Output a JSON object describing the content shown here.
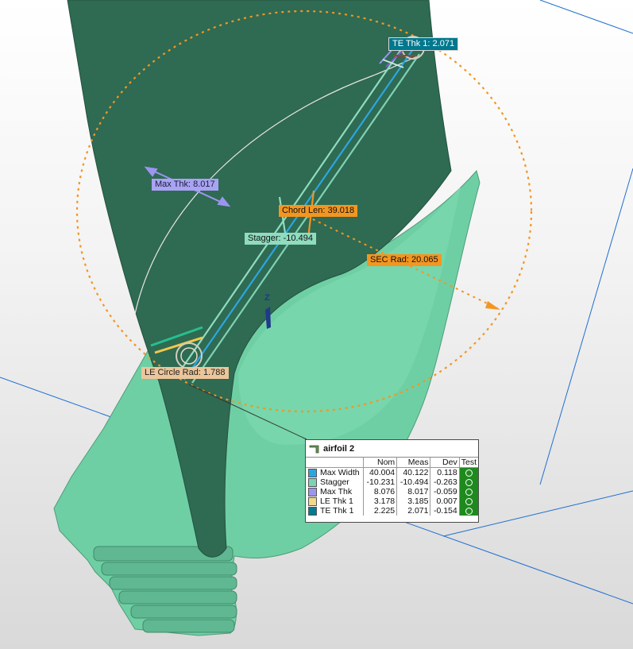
{
  "callouts": {
    "te_thk": "TE Thk 1: 2.071",
    "max_thk": "Max Thk: 8.017",
    "chord_len": "Chord Len: 39.018",
    "stagger": "Stagger: -10.494",
    "sec_rad": "SEC Rad: 20.065",
    "le_circle_rad": "LE Circle Rad: 1.788"
  },
  "axis_label": "Z",
  "panel": {
    "title": "airfoil 2",
    "headers": [
      "",
      "",
      "Nom",
      "Meas",
      "Dev",
      "Test"
    ],
    "rows": [
      {
        "color": "#2aa7e0",
        "name": "Max Width",
        "nom": "40.004",
        "meas": "40.122",
        "dev": "0.118"
      },
      {
        "color": "#7fd2b5",
        "name": "Stagger",
        "nom": "-10.231",
        "meas": "-10.494",
        "dev": "-0.263"
      },
      {
        "color": "#9b95f0",
        "name": "Max Thk",
        "nom": "8.076",
        "meas": "8.017",
        "dev": "-0.059"
      },
      {
        "color": "#f2d88a",
        "name": "LE Thk 1",
        "nom": "3.178",
        "meas": "3.185",
        "dev": "0.007"
      },
      {
        "color": "#007b8f",
        "name": "TE Thk 1",
        "nom": "2.225",
        "meas": "2.071",
        "dev": "-0.154"
      }
    ]
  },
  "colors": {
    "blade_dark": "#2f6a52",
    "blade_light": "#6fcfa4",
    "measurement_orange": "#f39621",
    "plane_line": "#1f6fd0",
    "test_pass": "#1e8a1e"
  }
}
